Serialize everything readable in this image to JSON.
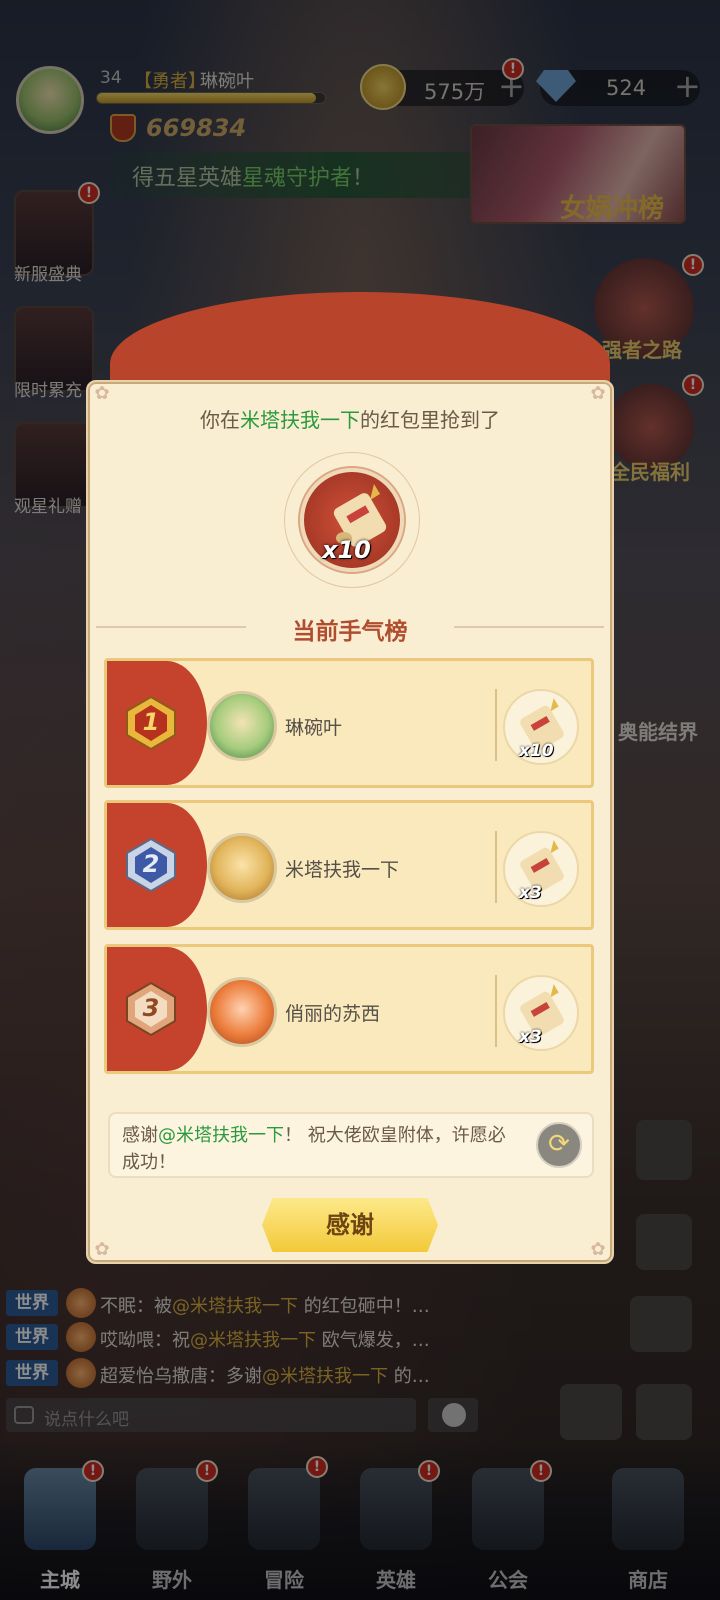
{
  "player": {
    "level": "34",
    "title": "【勇者】",
    "name": "琳碗叶",
    "xp_fraction": 0.96,
    "power": "669834"
  },
  "currency": {
    "gold": "575万",
    "gems": "524",
    "plus": "+"
  },
  "ticker": {
    "prefix": "得五星英雄",
    "highlight": "星魂守护者",
    "suffix": "！"
  },
  "event_banner": {
    "label": "女娲冲榜"
  },
  "side_left": [
    {
      "label": "新服盛典",
      "badge": "!"
    },
    {
      "label": "限时累充",
      "badge": ""
    },
    {
      "label": "观星礼赠",
      "badge": ""
    }
  ],
  "side_right": [
    {
      "label": "强者之路",
      "badge": "!"
    },
    {
      "label": "全民福利",
      "badge": "!"
    },
    {
      "label": "奥能结界",
      "badge": ""
    }
  ],
  "modal": {
    "header_prefix": "你在",
    "header_sender": "米塔扶我一下",
    "header_suffix": "的红包里抢到了",
    "reward_count": "x10",
    "section_title": "当前手气榜",
    "ranking": [
      {
        "rank": "1",
        "name": "琳碗叶",
        "reward": "x10"
      },
      {
        "rank": "2",
        "name": "米塔扶我一下",
        "reward": "x3"
      },
      {
        "rank": "3",
        "name": "俏丽的苏西",
        "reward": "x3"
      }
    ],
    "wish_prefix": "感谢",
    "wish_mention": "@米塔扶我一下",
    "wish_suffix": "！ 祝大佬欧皇附体，许愿必成功！",
    "thanks_button": "感谢",
    "refresh_icon": "refresh-icon"
  },
  "chat": [
    {
      "tag": "世界",
      "prefix": "不眠：被",
      "mention": "@米塔扶我一下",
      "suffix": " 的红包砸中！…"
    },
    {
      "tag": "世界",
      "prefix": "哎呦喂：祝",
      "mention": "@米塔扶我一下",
      "suffix": " 欧气爆发，…"
    },
    {
      "tag": "世界",
      "prefix": "超爱怡乌撒唐：多谢",
      "mention": "@米塔扶我一下",
      "suffix": " 的…"
    }
  ],
  "chat_input": {
    "placeholder": "说点什么吧"
  },
  "bottom_nav": [
    {
      "label": "主城",
      "active": true
    },
    {
      "label": "野外"
    },
    {
      "label": "冒险"
    },
    {
      "label": "英雄"
    },
    {
      "label": "公会"
    },
    {
      "label": "商店"
    }
  ],
  "colors": {
    "envelope_red": "#b8452b",
    "modal_bg": "#f9edd2",
    "green_highlight": "#2a9a3e",
    "gold_button": "#f3c93a",
    "chat_tag_blue": "#2f5e9c"
  }
}
